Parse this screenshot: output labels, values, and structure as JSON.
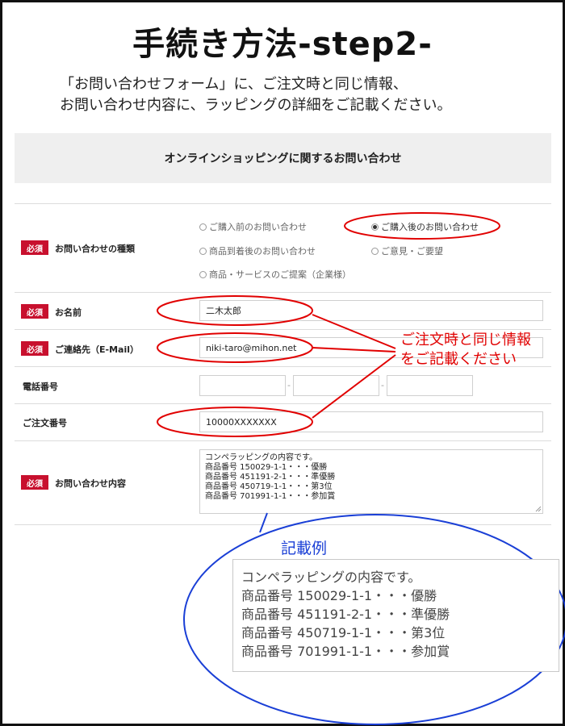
{
  "page_title": "手続き方法-step2-",
  "intro_lines": [
    "「お問い合わせフォーム」に、ご注文時と同じ情報、",
    "お問い合わせ内容に、ラッピングの詳細をご記載ください。"
  ],
  "form": {
    "header": "オンラインショッピングに関するお問い合わせ",
    "required_label": "必須",
    "inquiry_type": {
      "label": "お問い合わせの種類",
      "options": [
        "ご購入前のお問い合わせ",
        "ご購入後のお問い合わせ",
        "商品到着後のお問い合わせ",
        "ご意見・ご要望",
        "商品・サービスのご提案（企業様）"
      ],
      "selected": "ご購入後のお問い合わせ"
    },
    "name": {
      "label": "お名前",
      "value": "二木太郎"
    },
    "email": {
      "label": "ご連絡先（E-Mail）",
      "value": "niki-taro@mihon.net"
    },
    "phone": {
      "label": "電話番号",
      "separator": "-"
    },
    "order_number": {
      "label": "ご注文番号",
      "value": "10000XXXXXXX"
    },
    "inquiry_content": {
      "label": "お問い合わせ内容",
      "lines": [
        "コンペラッピングの内容です。",
        "商品番号 150029-1-1・・・優勝",
        "商品番号 451191-2-1・・・準優勝",
        "商品番号 450719-1-1・・・第3位",
        "商品番号 701991-1-1・・・参加賞"
      ]
    }
  },
  "callout_lines": [
    "ご注文時と同じ情報",
    "をご記載ください"
  ],
  "example_label": "記載例",
  "colors": {
    "required_badge": "#c8102e",
    "annotation_red": "#e10000",
    "annotation_blue": "#1a3fd6"
  }
}
